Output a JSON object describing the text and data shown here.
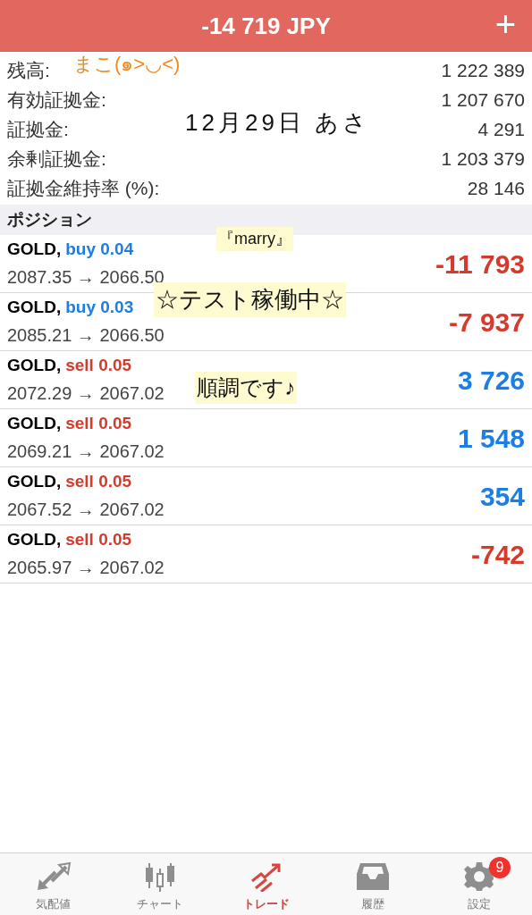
{
  "header": {
    "title": "-14 719 JPY",
    "add": "+"
  },
  "summary": [
    {
      "label": "残高:",
      "value": "1 222 389"
    },
    {
      "label": "有効証拠金:",
      "value": "1 207 670"
    },
    {
      "label": "証拠金:",
      "value": "4 291"
    },
    {
      "label": "余剰証拠金:",
      "value": "1 203 379"
    },
    {
      "label": "証拠金維持率 (%):",
      "value": "28 146"
    }
  ],
  "section": "ポジション",
  "positions": [
    {
      "symbol": "GOLD,",
      "kind": "buy",
      "order": "buy 0.04",
      "prices": "2087.35 → 2066.50",
      "profit": "-11 793",
      "loss": true
    },
    {
      "symbol": "GOLD,",
      "kind": "buy",
      "order": "buy 0.03",
      "prices": "2085.21 → 2066.50",
      "profit": "-7 937",
      "loss": true
    },
    {
      "symbol": "GOLD,",
      "kind": "sell",
      "order": "sell 0.05",
      "prices": "2072.29 → 2067.02",
      "profit": "3 726",
      "loss": false
    },
    {
      "symbol": "GOLD,",
      "kind": "sell",
      "order": "sell 0.05",
      "prices": "2069.21 → 2067.02",
      "profit": "1 548",
      "loss": false
    },
    {
      "symbol": "GOLD,",
      "kind": "sell",
      "order": "sell 0.05",
      "prices": "2067.52 → 2067.02",
      "profit": "354",
      "loss": false
    },
    {
      "symbol": "GOLD,",
      "kind": "sell",
      "order": "sell 0.05",
      "prices": "2065.97 → 2067.02",
      "profit": "-742",
      "loss": true
    }
  ],
  "annotations": [
    {
      "text": "まこ(๑>◡<)",
      "color": "#f08a1c"
    },
    {
      "text": "12月29日 あさ",
      "color": "#111111"
    },
    {
      "text": "『marry』",
      "color": "#111111"
    },
    {
      "text": "☆テスト稼働中☆",
      "color": "#111111"
    },
    {
      "text": "順調です♪",
      "color": "#111111"
    }
  ],
  "tabs": [
    {
      "label": "気配値",
      "kind": "quotes",
      "selected": false
    },
    {
      "label": "チャート",
      "kind": "chart",
      "selected": false
    },
    {
      "label": "トレード",
      "kind": "trade",
      "selected": true
    },
    {
      "label": "履歴",
      "kind": "history",
      "selected": false
    },
    {
      "label": "設定",
      "kind": "settings",
      "selected": false,
      "badge": "9"
    }
  ]
}
